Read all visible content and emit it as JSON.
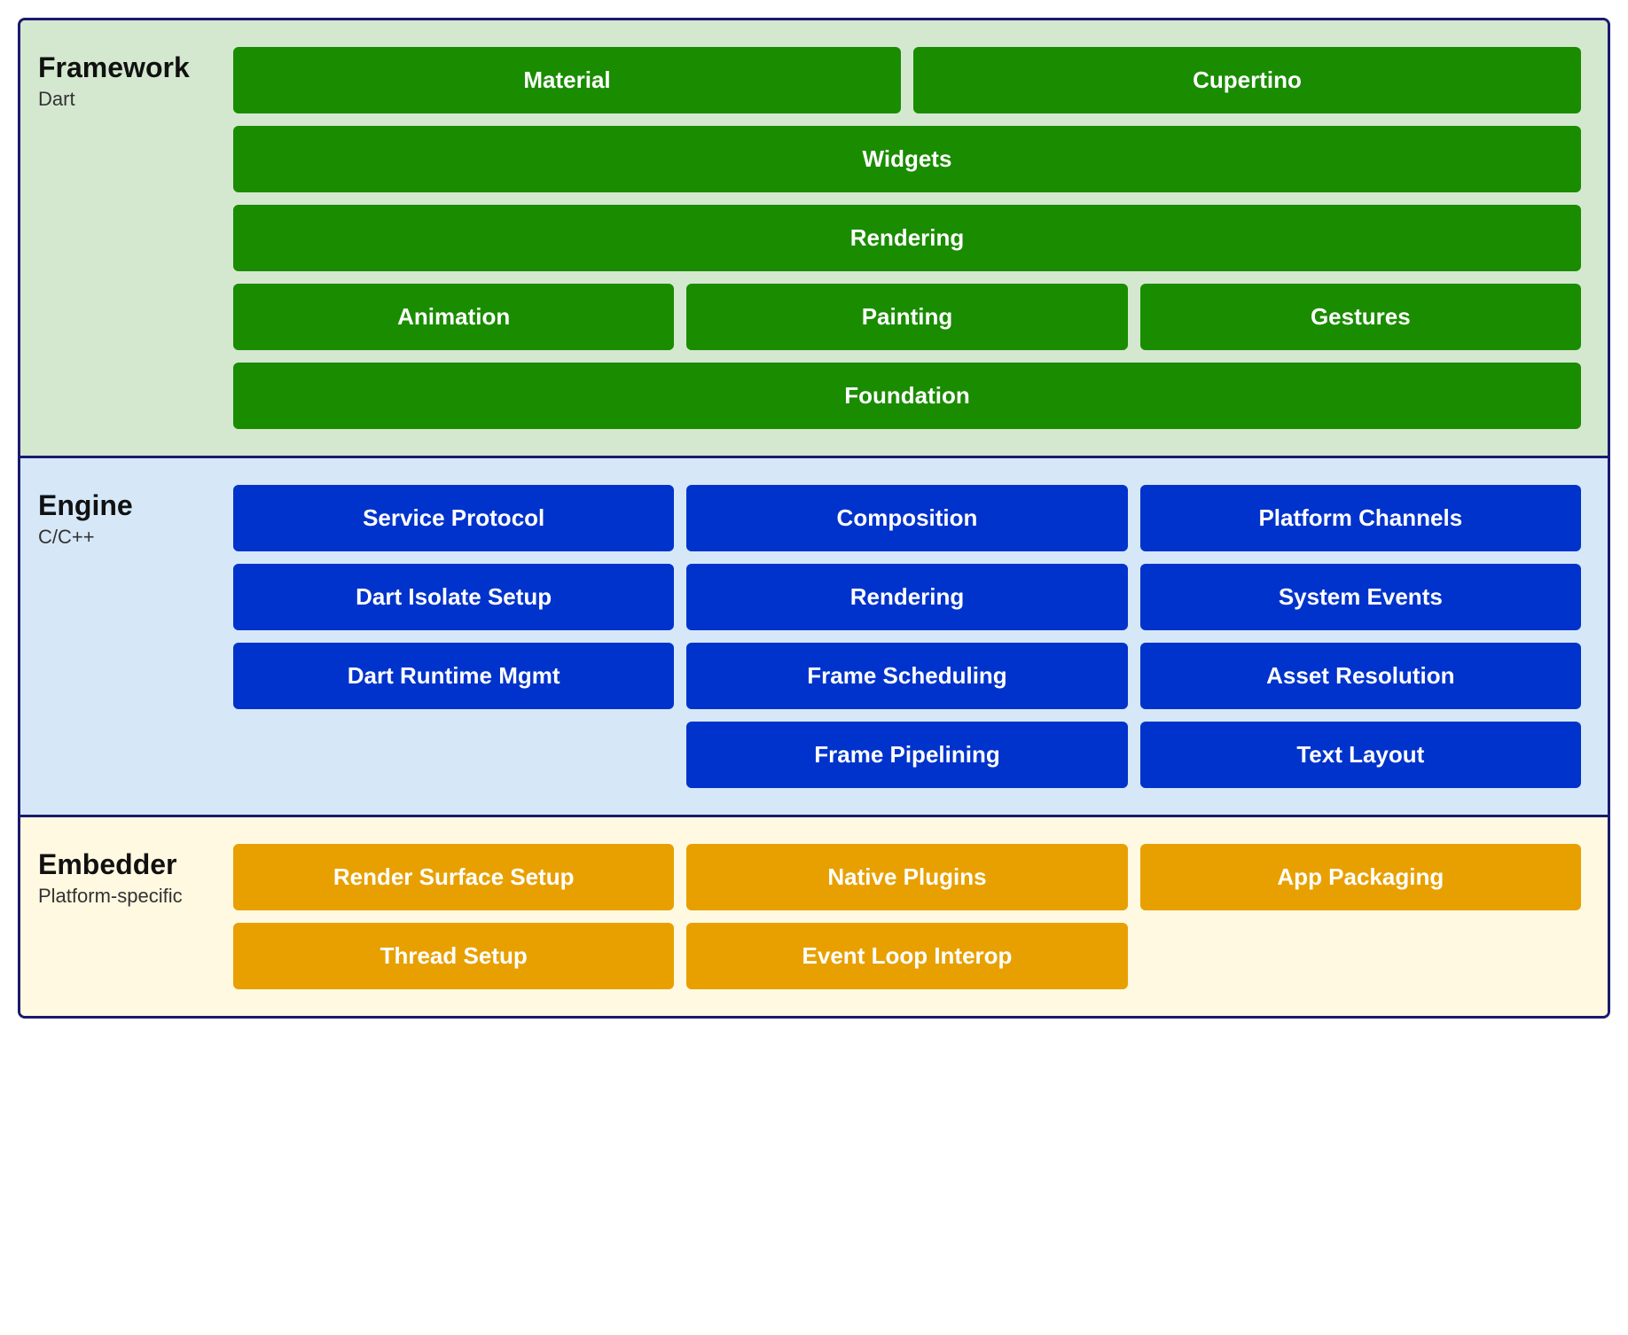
{
  "framework": {
    "title": "Framework",
    "subtitle": "Dart",
    "rows": [
      [
        {
          "label": "Material",
          "span": 1
        },
        {
          "label": "Cupertino",
          "span": 1
        }
      ],
      [
        {
          "label": "Widgets",
          "span": 2
        }
      ],
      [
        {
          "label": "Rendering",
          "span": 2
        }
      ],
      [
        {
          "label": "Animation",
          "span": 1
        },
        {
          "label": "Painting",
          "span": 1
        },
        {
          "label": "Gestures",
          "span": 1
        }
      ],
      [
        {
          "label": "Foundation",
          "span": 2
        }
      ]
    ]
  },
  "engine": {
    "title": "Engine",
    "subtitle": "C/C++",
    "rows": [
      [
        {
          "label": "Service Protocol"
        },
        {
          "label": "Composition"
        },
        {
          "label": "Platform Channels"
        }
      ],
      [
        {
          "label": "Dart Isolate Setup"
        },
        {
          "label": "Rendering"
        },
        {
          "label": "System Events"
        }
      ],
      [
        {
          "label": "Dart Runtime Mgmt"
        },
        {
          "label": "Frame Scheduling"
        },
        {
          "label": "Asset Resolution"
        }
      ],
      [
        {
          "label": ""
        },
        {
          "label": "Frame Pipelining"
        },
        {
          "label": "Text Layout"
        }
      ]
    ]
  },
  "embedder": {
    "title": "Embedder",
    "subtitle": "Platform-specific",
    "rows": [
      [
        {
          "label": "Render Surface Setup"
        },
        {
          "label": "Native Plugins"
        },
        {
          "label": "App Packaging"
        }
      ],
      [
        {
          "label": "Thread Setup"
        },
        {
          "label": "Event Loop Interop"
        },
        {
          "label": ""
        }
      ]
    ]
  }
}
